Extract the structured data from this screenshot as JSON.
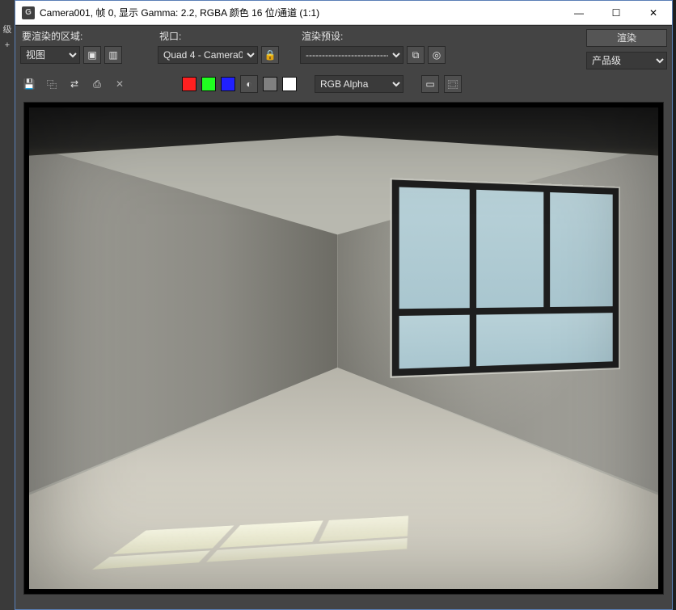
{
  "titlebar": {
    "app_icon_label": "G",
    "title": "Camera001, 帧 0, 显示 Gamma: 2.2, RGBA 颜色 16 位/通道 (1:1)"
  },
  "row1": {
    "area_label": "要渲染的区域:",
    "area_value": "视图",
    "viewport_label": "视口:",
    "viewport_value": "Quad 4 - Camera0",
    "preset_label": "渲染预设:",
    "preset_value": "--------------------------",
    "render_button": "渲染",
    "quality_label": "",
    "quality_value": "产品级"
  },
  "row2": {
    "channel_value": "RGB Alpha"
  },
  "icons": {
    "minimize": "—",
    "maximize": "☐",
    "close": "✕",
    "region_a": "▣",
    "region_b": "▥",
    "lock": "🔒",
    "preset_a": "⧉",
    "preset_b": "◎",
    "save": "💾",
    "copy": "⿻",
    "clone": "⇄",
    "print": "⎙",
    "delete": "✕",
    "alpha": "◐",
    "frame_a": "▭",
    "frame_b": "⿴"
  },
  "leftstrip": {
    "a": "级",
    "b": "+"
  }
}
